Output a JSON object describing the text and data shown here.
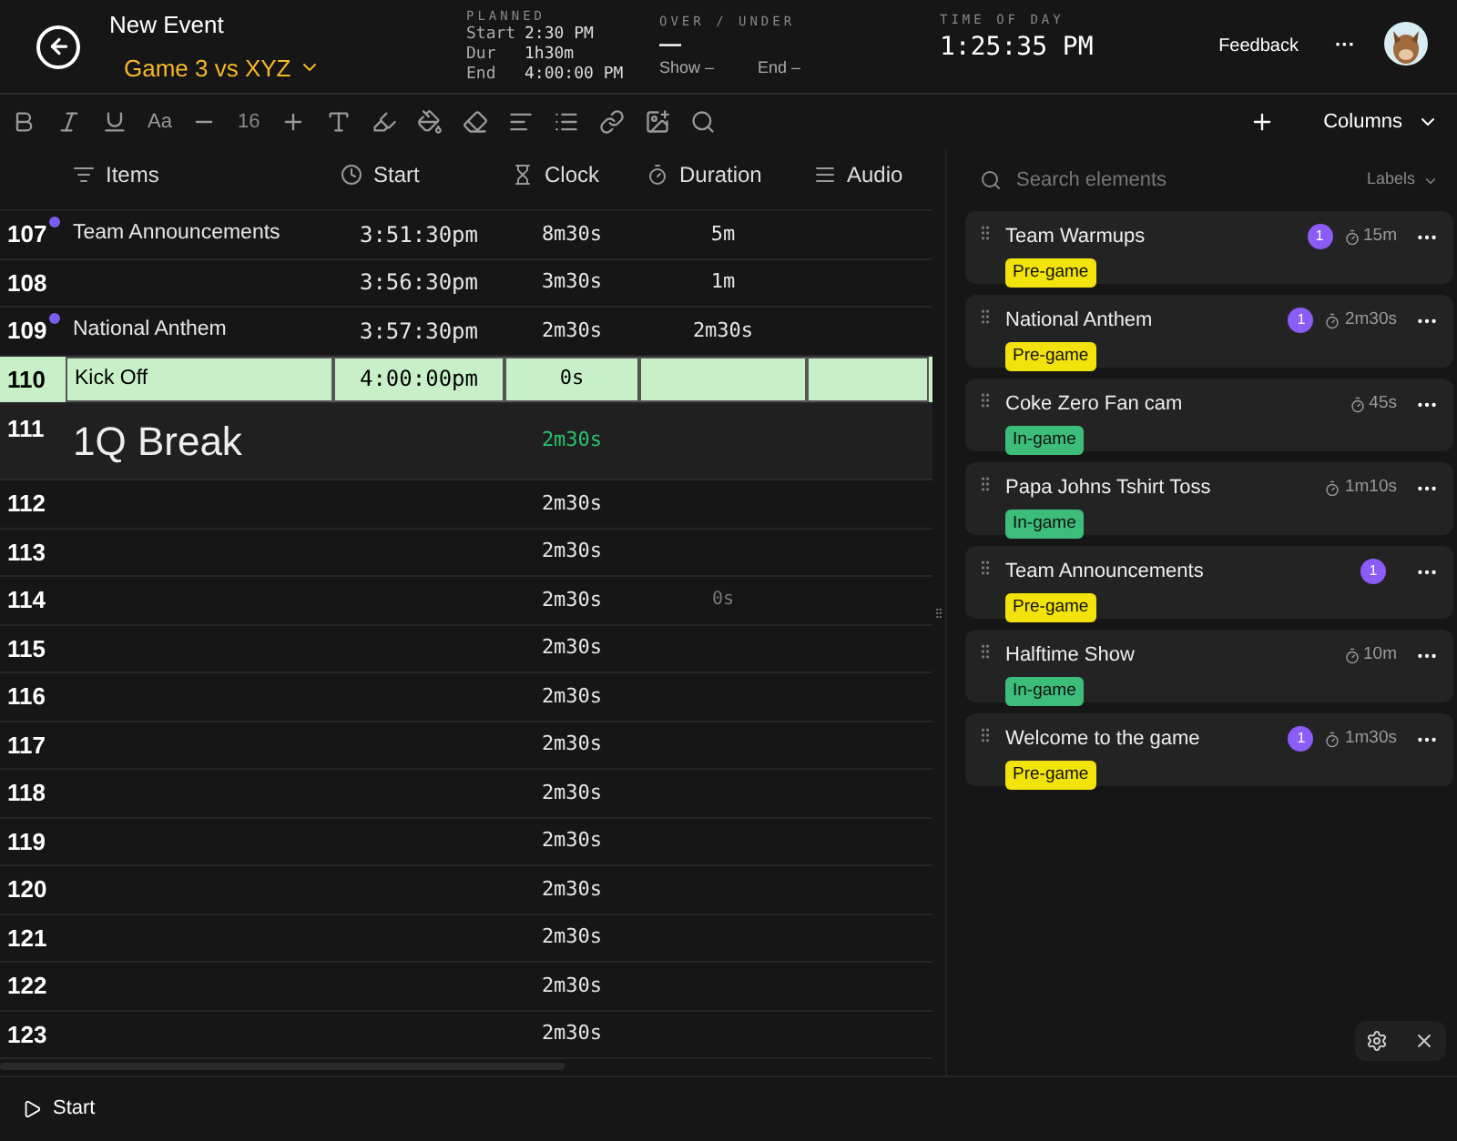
{
  "header": {
    "title": "New Event",
    "event": "Game 3 vs XYZ",
    "planned": {
      "label": "PLANNED",
      "rows": [
        {
          "key": "Start",
          "value": "2:30 PM"
        },
        {
          "key": "Dur",
          "value": "1h30m"
        },
        {
          "key": "End",
          "value": "4:00:00 PM"
        }
      ]
    },
    "over_under": {
      "label": "OVER / UNDER",
      "value": "—",
      "show": "Show –",
      "end": "End –"
    },
    "time_of_day": {
      "label": "TIME OF DAY",
      "value": "1:25:35 PM"
    },
    "feedback": "Feedback",
    "more": "···"
  },
  "toolbar": {
    "case_label": "Aa",
    "font_size": "16",
    "columns": "Columns"
  },
  "table": {
    "columns": [
      {
        "kind": "items",
        "label": "Items"
      },
      {
        "kind": "start",
        "label": "Start"
      },
      {
        "kind": "clock",
        "label": "Clock"
      },
      {
        "kind": "duration",
        "label": "Duration"
      },
      {
        "kind": "audio",
        "label": "Audio"
      }
    ],
    "rows": [
      {
        "kind": "item",
        "number": "107",
        "marker": true,
        "selected": false,
        "title": "Team Announcements",
        "start": "3:51:30pm",
        "clock": "8m30s",
        "duration": "5m"
      },
      {
        "kind": "item",
        "number": "108",
        "marker": false,
        "selected": false,
        "start": "3:56:30pm",
        "clock": "3m30s",
        "duration": "1m"
      },
      {
        "kind": "item",
        "number": "109",
        "marker": true,
        "selected": false,
        "title": "National Anthem",
        "start": "3:57:30pm",
        "clock": "2m30s",
        "duration": "2m30s"
      },
      {
        "kind": "item",
        "number": "110",
        "marker": false,
        "selected": true,
        "title": "Kick Off",
        "start": "4:00:00pm",
        "clock": "0s"
      },
      {
        "kind": "break",
        "number": "111",
        "marker": false,
        "selected": false,
        "title": "1Q Break",
        "clock": "2m30s"
      },
      {
        "kind": "item",
        "number": "112",
        "marker": false,
        "selected": false,
        "clock": "2m30s"
      },
      {
        "kind": "item",
        "number": "113",
        "marker": false,
        "selected": false,
        "clock": "2m30s"
      },
      {
        "kind": "item",
        "number": "114",
        "marker": false,
        "selected": false,
        "clock": "2m30s",
        "drag_ghost": "0s"
      },
      {
        "kind": "item",
        "number": "115",
        "marker": false,
        "selected": false,
        "clock": "2m30s"
      },
      {
        "kind": "item",
        "number": "116",
        "marker": false,
        "selected": false,
        "clock": "2m30s"
      },
      {
        "kind": "item",
        "number": "117",
        "marker": false,
        "selected": false,
        "clock": "2m30s"
      },
      {
        "kind": "item",
        "number": "118",
        "marker": false,
        "selected": false,
        "clock": "2m30s"
      },
      {
        "kind": "item",
        "number": "119",
        "marker": false,
        "selected": false,
        "clock": "2m30s"
      },
      {
        "kind": "item",
        "number": "120",
        "marker": false,
        "selected": false,
        "clock": "2m30s"
      },
      {
        "kind": "item",
        "number": "121",
        "marker": false,
        "selected": false,
        "clock": "2m30s"
      },
      {
        "kind": "item",
        "number": "122",
        "marker": false,
        "selected": false,
        "clock": "2m30s"
      },
      {
        "kind": "item",
        "number": "123",
        "marker": false,
        "selected": false,
        "clock": "2m30s"
      }
    ]
  },
  "elements": {
    "search": {
      "placeholder": "Search elements"
    },
    "labels": "Labels",
    "cards": [
      {
        "title": "Team Warmups",
        "count": "1",
        "duration": "15m",
        "tag": {
          "label": "Pre-game",
          "color": "#f2e30c"
        }
      },
      {
        "title": "National Anthem",
        "count": "1",
        "duration": "2m30s",
        "tag": {
          "label": "Pre-game",
          "color": "#f2e30c"
        }
      },
      {
        "title": "Coke Zero Fan cam",
        "duration": "45s",
        "tag": {
          "label": "In-game",
          "color": "#3dbd7a"
        }
      },
      {
        "title": "Papa Johns Tshirt Toss",
        "duration": "1m10s",
        "tag": {
          "label": "In-game",
          "color": "#3dbd7a"
        }
      },
      {
        "title": "Team Announcements",
        "count": "1",
        "tag": {
          "label": "Pre-game",
          "color": "#f2e30c"
        }
      },
      {
        "title": "Halftime Show",
        "duration": "10m",
        "tag": {
          "label": "In-game",
          "color": "#3dbd7a"
        }
      },
      {
        "title": "Welcome to the game",
        "count": "1",
        "duration": "1m30s",
        "tag": {
          "label": "Pre-game",
          "color": "#f2e30c"
        }
      }
    ]
  },
  "footer": {
    "start": "Start"
  }
}
